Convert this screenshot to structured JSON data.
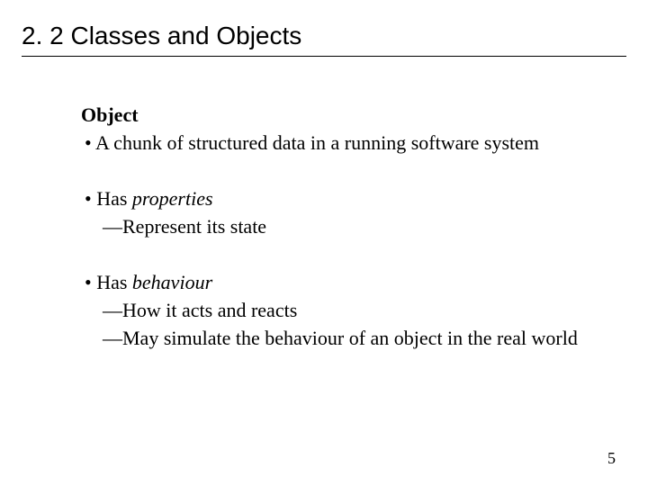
{
  "title": "2. 2 Classes and Objects",
  "subhead": "Object",
  "bullets": {
    "b1": "A chunk of structured data in a running software system",
    "b2_pre": "Has ",
    "b2_em": "properties",
    "b2_sub1": "Represent its state",
    "b3_pre": "Has ",
    "b3_em": "behaviour",
    "b3_sub1": "How it acts and reacts",
    "b3_sub2": "May simulate the behaviour of an object in the real world"
  },
  "page_number": "5"
}
